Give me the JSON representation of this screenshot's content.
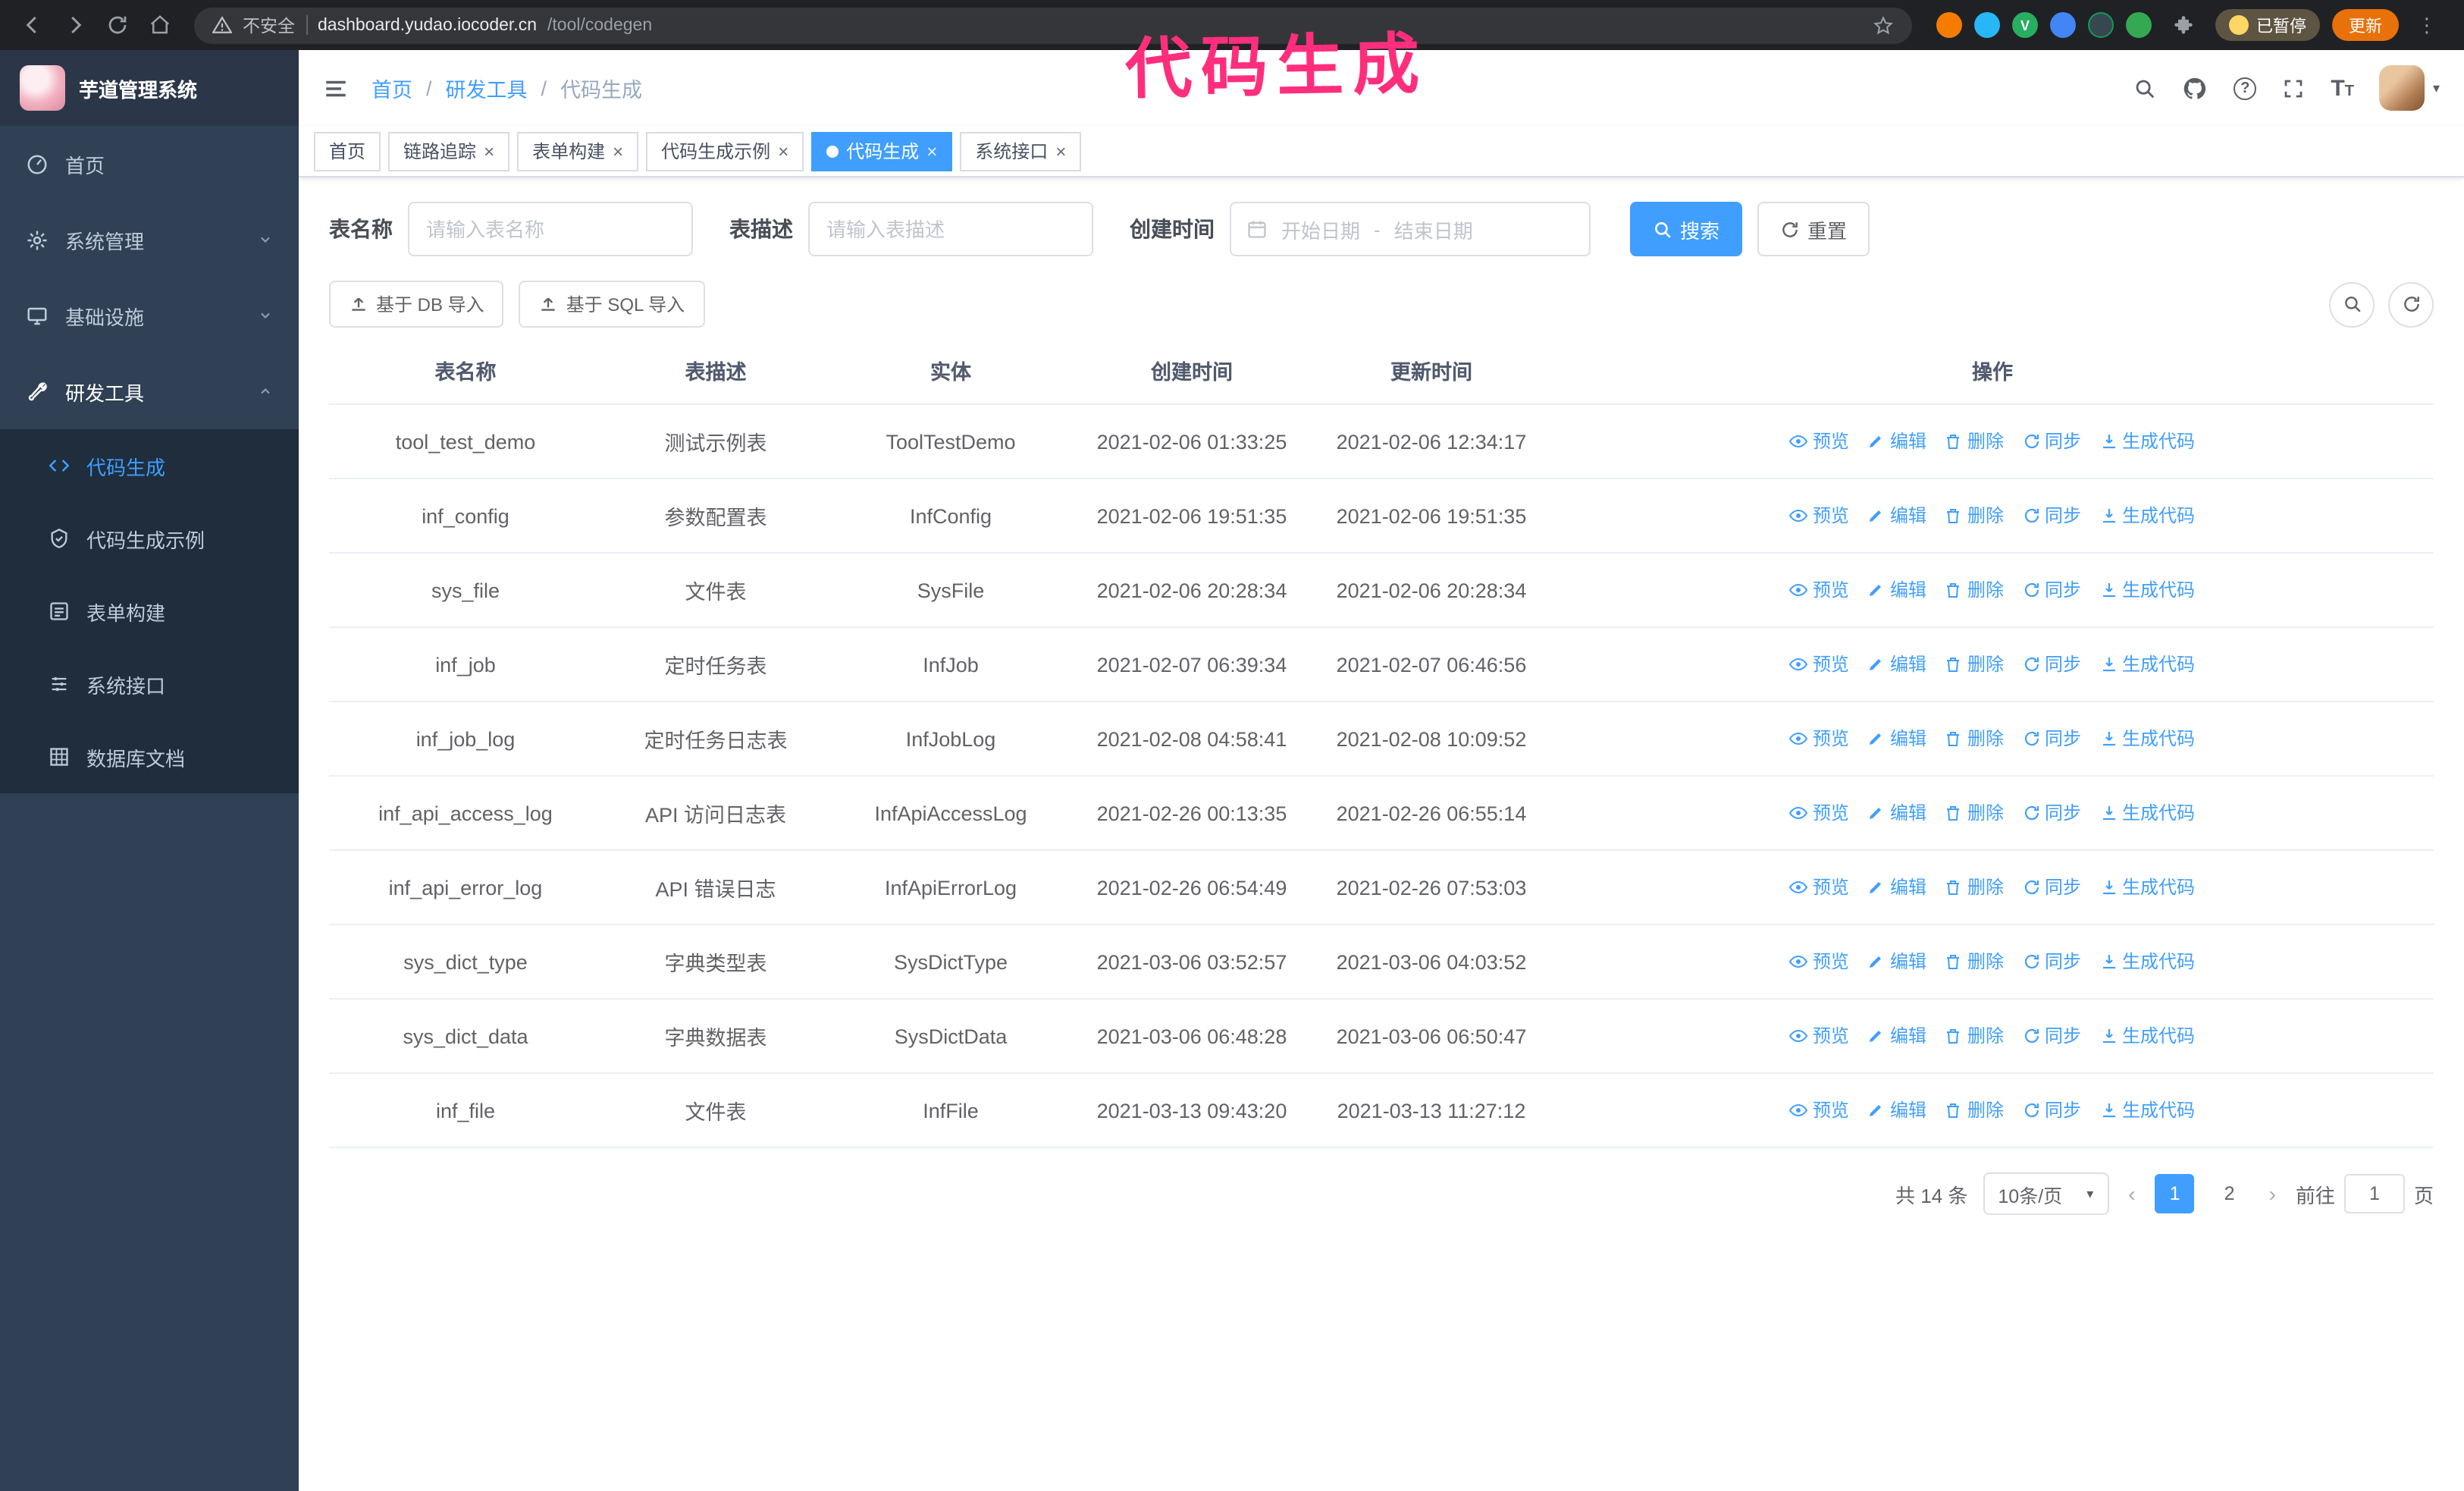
{
  "browser": {
    "security_label": "不安全",
    "url_domain": "dashboard.yudao.iocoder.cn",
    "url_path": "/tool/codegen",
    "paused_badge": "已暂停",
    "update_button": "更新",
    "ext_v_label": "V"
  },
  "annotation": {
    "text": "代码生成",
    "color": "#ff2e7c"
  },
  "sidebar": {
    "logo_title": "芋道管理系统",
    "items": [
      {
        "label": "首页"
      },
      {
        "label": "系统管理"
      },
      {
        "label": "基础设施"
      },
      {
        "label": "研发工具"
      }
    ],
    "sub_items": [
      {
        "label": "代码生成"
      },
      {
        "label": "代码生成示例"
      },
      {
        "label": "表单构建"
      },
      {
        "label": "系统接口"
      },
      {
        "label": "数据库文档"
      }
    ]
  },
  "breadcrumb": {
    "items": [
      "首页",
      "研发工具",
      "代码生成"
    ]
  },
  "tabs": [
    {
      "label": "首页"
    },
    {
      "label": "链路追踪"
    },
    {
      "label": "表单构建"
    },
    {
      "label": "代码生成示例"
    },
    {
      "label": "代码生成"
    },
    {
      "label": "系统接口"
    }
  ],
  "filters": {
    "table_name_label": "表名称",
    "table_name_placeholder": "请输入表名称",
    "table_desc_label": "表描述",
    "table_desc_placeholder": "请输入表描述",
    "create_time_label": "创建时间",
    "date_start_placeholder": "开始日期",
    "date_separator": "-",
    "date_end_placeholder": "结束日期",
    "search_button": "搜索",
    "reset_button": "重置"
  },
  "toolbar": {
    "import_db_button": "基于 DB 导入",
    "import_sql_button": "基于 SQL 导入"
  },
  "table": {
    "columns": [
      "表名称",
      "表描述",
      "实体",
      "创建时间",
      "更新时间",
      "操作"
    ],
    "actions": [
      "预览",
      "编辑",
      "删除",
      "同步",
      "生成代码"
    ],
    "rows": [
      {
        "name": "tool_test_demo",
        "desc": "测试示例表",
        "entity": "ToolTestDemo",
        "created": "2021-02-06 01:33:25",
        "updated": "2021-02-06 12:34:17"
      },
      {
        "name": "inf_config",
        "desc": "参数配置表",
        "entity": "InfConfig",
        "created": "2021-02-06 19:51:35",
        "updated": "2021-02-06 19:51:35"
      },
      {
        "name": "sys_file",
        "desc": "文件表",
        "entity": "SysFile",
        "created": "2021-02-06 20:28:34",
        "updated": "2021-02-06 20:28:34"
      },
      {
        "name": "inf_job",
        "desc": "定时任务表",
        "entity": "InfJob",
        "created": "2021-02-07 06:39:34",
        "updated": "2021-02-07 06:46:56"
      },
      {
        "name": "inf_job_log",
        "desc": "定时任务日志表",
        "entity": "InfJobLog",
        "created": "2021-02-08 04:58:41",
        "updated": "2021-02-08 10:09:52"
      },
      {
        "name": "inf_api_access_log",
        "desc": "API 访问日志表",
        "entity": "InfApiAccessLog",
        "created": "2021-02-26 00:13:35",
        "updated": "2021-02-26 06:55:14"
      },
      {
        "name": "inf_api_error_log",
        "desc": "API 错误日志",
        "entity": "InfApiErrorLog",
        "created": "2021-02-26 06:54:49",
        "updated": "2021-02-26 07:53:03"
      },
      {
        "name": "sys_dict_type",
        "desc": "字典类型表",
        "entity": "SysDictType",
        "created": "2021-03-06 03:52:57",
        "updated": "2021-03-06 04:03:52"
      },
      {
        "name": "sys_dict_data",
        "desc": "字典数据表",
        "entity": "SysDictData",
        "created": "2021-03-06 06:48:28",
        "updated": "2021-03-06 06:50:47"
      },
      {
        "name": "inf_file",
        "desc": "文件表",
        "entity": "InfFile",
        "created": "2021-03-13 09:43:20",
        "updated": "2021-03-13 11:27:12"
      }
    ]
  },
  "pagination": {
    "total": "共 14 条",
    "page_size": "10条/页",
    "pages": [
      "1",
      "2"
    ],
    "goto_label": "前往",
    "goto_value": "1",
    "goto_suffix": "页"
  },
  "colors": {
    "primary": "#409EFF",
    "sidebar_bg": "#304156",
    "submenu_bg": "#1f2d3d",
    "annotation": "#ff2e7c",
    "update_button": "#e8710a"
  }
}
